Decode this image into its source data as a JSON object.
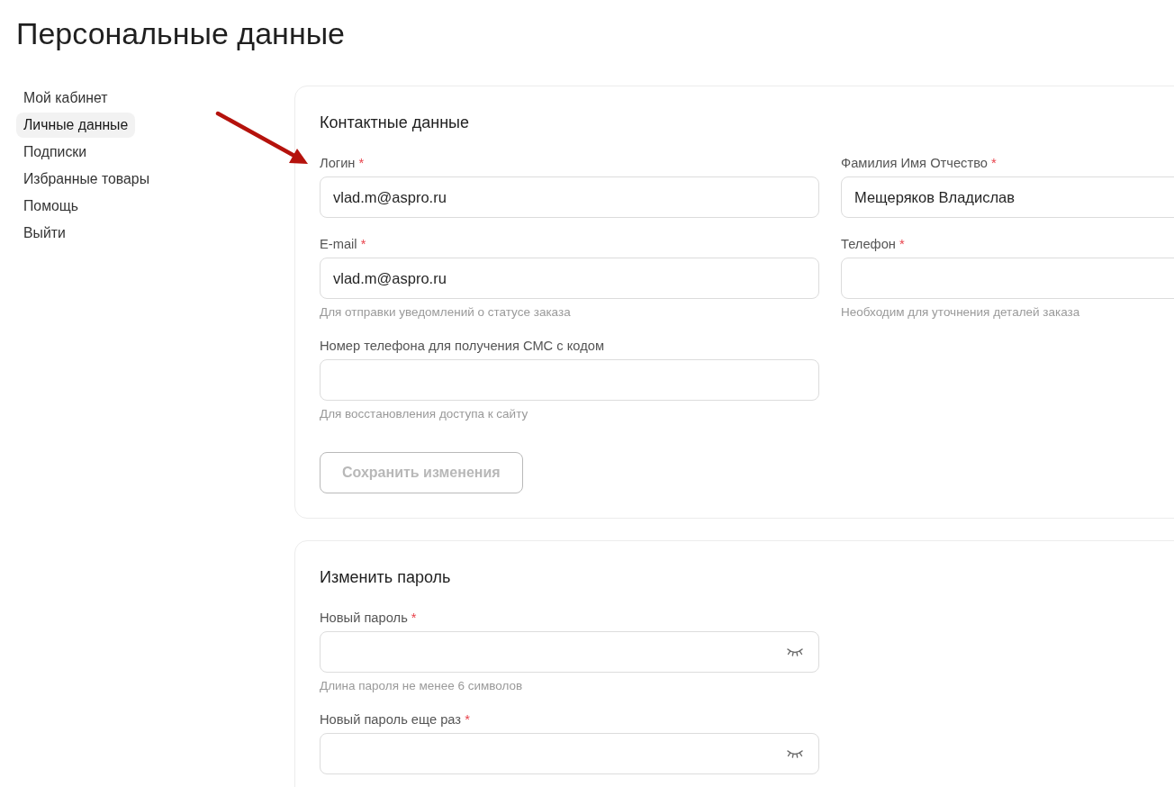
{
  "page": {
    "title": "Персональные данные"
  },
  "sidebar": {
    "items": [
      {
        "label": "Мой кабинет",
        "selected": false
      },
      {
        "label": "Личные данные",
        "selected": true
      },
      {
        "label": "Подписки",
        "selected": false
      },
      {
        "label": "Избранные товары",
        "selected": false
      },
      {
        "label": "Помощь",
        "selected": false
      },
      {
        "label": "Выйти",
        "selected": false
      }
    ]
  },
  "sections": [
    {
      "title": "Контактные данные",
      "fields": [
        {
          "kind": "text",
          "label": "Логин",
          "required_mark": "*",
          "value": "vlad.m@aspro.ru"
        },
        {
          "kind": "text",
          "label": "Фамилия Имя Отчество",
          "required_mark": "*",
          "value": "Мещеряков Владислав"
        },
        {
          "kind": "text",
          "label": "E-mail",
          "required_mark": "*",
          "value": "vlad.m@aspro.ru",
          "hint": "Для отправки уведомлений о статусе заказа"
        },
        {
          "kind": "text",
          "label": "Телефон",
          "required_mark": "*",
          "hint": "Необходим для уточнения деталей заказа"
        },
        {
          "kind": "text",
          "label": "Номер телефона для получения СМС с кодом",
          "hint": "Для восстановления доступа к сайту"
        }
      ],
      "button": {
        "label": "Сохранить изменения",
        "disabled": true
      }
    },
    {
      "title": "Изменить пароль",
      "fields": [
        {
          "kind": "password",
          "label": "Новый пароль",
          "required_mark": "*",
          "hint": "Длина пароля не менее 6 символов"
        },
        {
          "kind": "password",
          "label": "Новый пароль еще раз",
          "required_mark": "*"
        }
      ]
    }
  ]
}
